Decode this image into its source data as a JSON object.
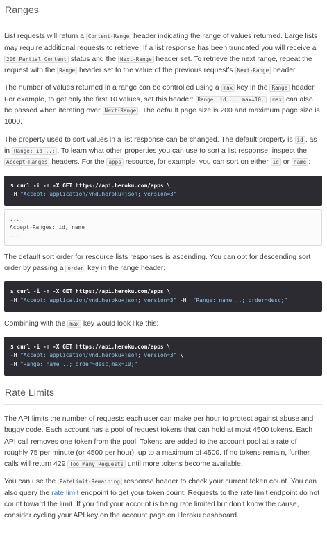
{
  "ranges": {
    "title": "Ranges",
    "p1": [
      "List requests will return a ",
      "Content-Range",
      " header indicating the range of values returned. Large lists may require additional requests to retrieve. If a list response has been truncated you will receive a ",
      "206 Partial Content",
      " status and the ",
      "Next-Range",
      " header set. To retrieve the next range, repeat the request with the ",
      "Range",
      " header set to the value of the previous request’s ",
      "Next-Range",
      " header."
    ],
    "p2": [
      "The number of values returned in a range can be controlled using a ",
      "max",
      " key in the ",
      "Range",
      " header. For example, to get only the first 10 values, set this header: ",
      "Range: id ..; max=10;",
      ". ",
      "max",
      " can also be passed when iterating over ",
      "Next-Range",
      ". The default page size is 200 and maximum page size is 1000."
    ],
    "p3": [
      "The property used to sort values in a list response can be changed. The default property is ",
      "id",
      ", as in ",
      "Range: id ..;",
      ". To learn what other properties you can use to sort a list response, inspect the ",
      "Accept-Ranges",
      " headers. For the ",
      "apps",
      " resource, for example, you can sort on either ",
      "id",
      " or ",
      "name",
      ":"
    ],
    "cmd1": {
      "cmd": "$ curl -i -n -X GET https://api.heroku.com/apps \\",
      "h1": "-H ",
      "h1s": "\"Accept: application/vnd.heroku+json; version=3\""
    },
    "output": {
      "l1": "...",
      "l2": "Accept-Ranges: id, name",
      "l3": "..."
    },
    "p4": [
      "The default sort order for resource lists responses is ascending. You can opt for descending sort order by passing a ",
      "order",
      " key in the range header:"
    ],
    "cmd2": {
      "cmd": "$ curl -i -n -X GET https://api.heroku.com/apps \\",
      "h1": "-H ",
      "h1s": "\"Accept: application/vnd.heroku+json; version=3\"",
      "h2": " -H ",
      "h2s": "\"Range: name ..; order=desc;\""
    },
    "p5": [
      "Combining with the ",
      "max",
      " key would look like this:"
    ],
    "cmd3": {
      "cmd": "$ curl -i -n -X GET https://api.heroku.com/apps \\",
      "h1": "-H ",
      "h1s": "\"Accept: application/vnd.heroku+json; version=3\"",
      "h1e": " \\",
      "h2": "-H ",
      "h2s": "\"Range: name ..; order=desc,max=10;\""
    }
  },
  "rate": {
    "title": "Rate Limits",
    "p1": "The API limits the number of requests each user can make per hour to protect against abuse and buggy code. Each account has a pool of request tokens that can hold at most 4500 tokens. Each API call removes one token from the pool. Tokens are added to the account pool at a rate of roughly 75 per minute (or 4500 per hour), up to a maximum of 4500. If no tokens remain, further calls will return 429 ",
    "p1code": "Too Many Requests",
    "p1end": " until more tokens become available.",
    "p2a": "You can use the ",
    "p2code": "RateLimit-Remaining",
    "p2b": " response header to check your current token count. You can also query the ",
    "p2link": "rate limit",
    "p2c": " endpoint to get your token count. Requests to the rate limit endpoint do not count toward the limit. If you find your account is being rate limited but don’t know the cause, consider cycling your API key on the account page on Heroku dashboard."
  }
}
